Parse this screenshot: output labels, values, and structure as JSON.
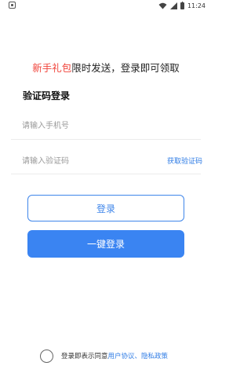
{
  "status_bar": {
    "time": "11:24"
  },
  "promo": {
    "highlight": "新手礼包",
    "text": "限时发送，登录即可领取"
  },
  "login_form": {
    "title": "验证码登录",
    "phone_placeholder": "请输入手机号",
    "code_placeholder": "请输入验证码",
    "get_code_label": "获取验证码",
    "login_button": "登录",
    "onekey_button": "一键登录"
  },
  "agreement": {
    "prefix": "登录即表示同意",
    "user_agreement": "用户协议",
    "separator": "、",
    "privacy_policy": "隐私政策"
  },
  "colors": {
    "accent": "#3a84f2",
    "highlight": "#f0443b"
  }
}
